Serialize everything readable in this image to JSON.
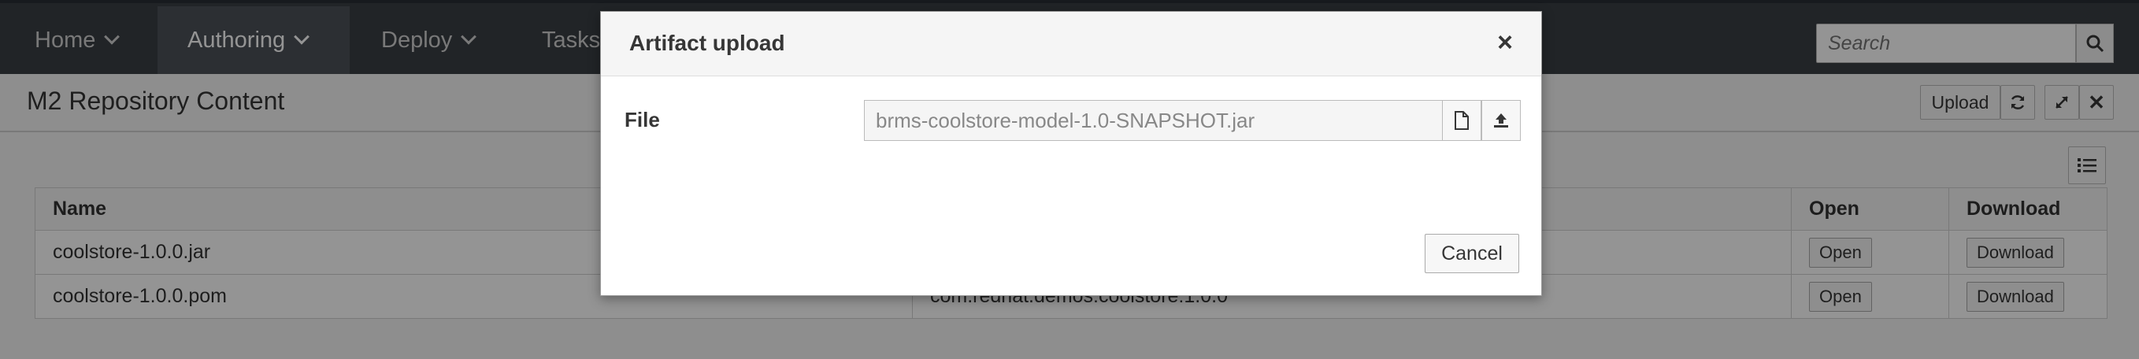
{
  "nav": {
    "items": [
      {
        "label": "Home"
      },
      {
        "label": "Authoring"
      },
      {
        "label": "Deploy"
      },
      {
        "label": "Tasks"
      }
    ],
    "search_placeholder": "Search"
  },
  "page": {
    "title": "M2 Repository Content",
    "upload_label": "Upload"
  },
  "table": {
    "headers": [
      "Name",
      "",
      "Open",
      "Download"
    ],
    "rows": [
      {
        "name": "coolstore-1.0.0.jar",
        "gav": "",
        "open": "Open",
        "download": "Download"
      },
      {
        "name": "coolstore-1.0.0.pom",
        "gav": "com.redhat.demos:coolstore:1.0.0",
        "open": "Open",
        "download": "Download"
      }
    ]
  },
  "modal": {
    "title": "Artifact upload",
    "close": "×",
    "file_label": "File",
    "file_value": "brms-coolstore-model-1.0-SNAPSHOT.jar",
    "cancel_label": "Cancel"
  },
  "colors": {
    "navbar": "#393f44",
    "navbar_active": "#4d5258"
  }
}
